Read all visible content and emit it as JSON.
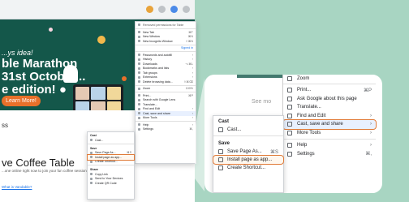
{
  "hero": {
    "tagline": "...ys idea!",
    "line1": "ble Marathon",
    "line2": "31st October...",
    "line3": "e edition! ●",
    "button": "Learn More!"
  },
  "page": {
    "section_fragment": "ss",
    "heading": "ve Coffee Table",
    "subtext": "...one online right now to join your fun coffee session!",
    "link": "What is Vandable?"
  },
  "small_menu": {
    "managed": "Removed permissions for Table",
    "items": [
      {
        "label": "New Tab",
        "sc": "⌘T"
      },
      {
        "label": "New Window",
        "sc": "⌘N"
      },
      {
        "label": "New Incognito Window",
        "sc": "⇧⌘N"
      }
    ],
    "signin_label": "",
    "signin_badge": "Signed in",
    "items2": [
      {
        "label": "Passwords and autofill",
        "sc": "›"
      },
      {
        "label": "History",
        "sc": "›"
      },
      {
        "label": "Downloads",
        "sc": "⌥⌘L"
      },
      {
        "label": "Bookmarks and lists",
        "sc": "›"
      },
      {
        "label": "Tab groups",
        "sc": "›"
      },
      {
        "label": "Extensions",
        "sc": "›"
      },
      {
        "label": "Delete browsing data...",
        "sc": "⇧⌘⌫"
      }
    ],
    "zoom_label": "Zoom",
    "zoom_value": "100%",
    "items3": [
      {
        "label": "Print...",
        "sc": "⌘P"
      },
      {
        "label": "Search with Google Lens",
        "sc": ""
      },
      {
        "label": "Translate...",
        "sc": ""
      },
      {
        "label": "Find and Edit",
        "sc": "›"
      },
      {
        "label": "Cast, save and share",
        "sc": "›"
      },
      {
        "label": "More Tools",
        "sc": "›"
      }
    ],
    "items4": [
      {
        "label": "Help",
        "sc": "›"
      },
      {
        "label": "Settings",
        "sc": "⌘,"
      }
    ]
  },
  "small_sub": {
    "cast_header": "Cast",
    "cast_item": "Cast...",
    "save_header": "Save",
    "save_items": [
      {
        "label": "Save Page As...",
        "sc": "⌘S"
      },
      {
        "label": "Install page as app...",
        "sc": ""
      },
      {
        "label": "Create Shortcut...",
        "sc": ""
      }
    ],
    "share_header": "Share",
    "share_items": [
      {
        "label": "Copy Link",
        "sc": ""
      },
      {
        "label": "Send to Your Devices",
        "sc": ""
      },
      {
        "label": "Create QR Code",
        "sc": ""
      }
    ]
  },
  "zoom_view": {
    "see_more": "See mo",
    "zoom_label": "Zoom",
    "items": [
      {
        "label": "Print...",
        "sc": "⌘P"
      },
      {
        "label": "Ask Google about this page",
        "sc": ""
      },
      {
        "label": "Translate...",
        "sc": ""
      },
      {
        "label": "Find and Edit",
        "sc": "›"
      },
      {
        "label": "Cast, save and share",
        "sc": "›"
      },
      {
        "label": "More Tools",
        "sc": "›"
      }
    ],
    "items2": [
      {
        "label": "Help",
        "sc": "›"
      },
      {
        "label": "Settings",
        "sc": "⌘,"
      }
    ],
    "sub": {
      "cast_header": "Cast",
      "cast_item": "Cast...",
      "save_header": "Save",
      "save_items": [
        {
          "label": "Save Page As...",
          "sc": "⌘S"
        },
        {
          "label": "Install page as app...",
          "sc": ""
        },
        {
          "label": "Create Shortcut...",
          "sc": ""
        }
      ]
    }
  },
  "colors": {
    "background": "#a8d5c2",
    "hero": "#14574a",
    "highlight_outline": "#e07b39"
  }
}
